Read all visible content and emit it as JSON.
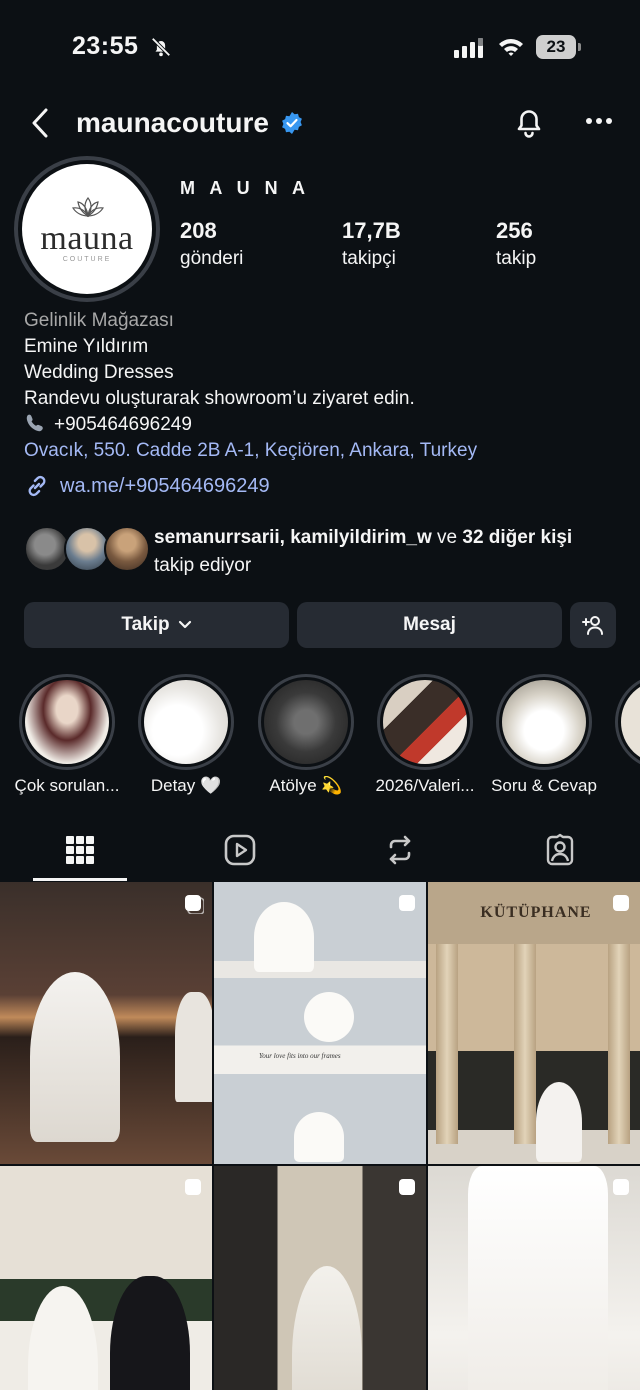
{
  "status_bar": {
    "time": "23:55",
    "battery": "23"
  },
  "header": {
    "username": "maunacouture"
  },
  "profile": {
    "avatar_text": "mauna",
    "avatar_sub": "COUTURE",
    "display_name": "M A U N A",
    "stats": {
      "posts_num": "208",
      "posts_label": "gönderi",
      "followers_num": "17,7B",
      "followers_label": "takipçi",
      "following_num": "256",
      "following_label": "takip"
    }
  },
  "bio": {
    "category": "Gelinlik Mağazası",
    "line1": "Emine Yıldırım",
    "line2": "Wedding Dresses",
    "line3": "Randevu oluşturarak showroom’u ziyaret edin.",
    "phone": "+905464696249",
    "address": "Ovacık, 550. Cadde 2B A-1, Keçiören, Ankara, Turkey",
    "link": "wa.me/+905464696249"
  },
  "followed_by": {
    "names": "semanurrsarii, kamilyildirim_w",
    "joiner": " ve ",
    "others": "32 diğer kişi",
    "suffix": "takip ediyor"
  },
  "buttons": {
    "follow": "Takip",
    "message": "Mesaj"
  },
  "highlights": [
    {
      "label": "Çok sorulan..."
    },
    {
      "label": "Detay 🤍"
    },
    {
      "label": "Atölye 💫"
    },
    {
      "label": "2026/Valeri..."
    },
    {
      "label": "Soru & Cevap"
    },
    {
      "label": ""
    }
  ],
  "posts": [
    {
      "text": ""
    },
    {
      "text": "Your love fits into our frames"
    },
    {
      "text": "KÜTÜPHANE"
    },
    {
      "text": ""
    },
    {
      "text": ""
    },
    {
      "text": ""
    }
  ],
  "colors": {
    "background": "#0c1014",
    "button": "#262b33",
    "link": "#a4b9f5",
    "verified": "#3897f0"
  }
}
